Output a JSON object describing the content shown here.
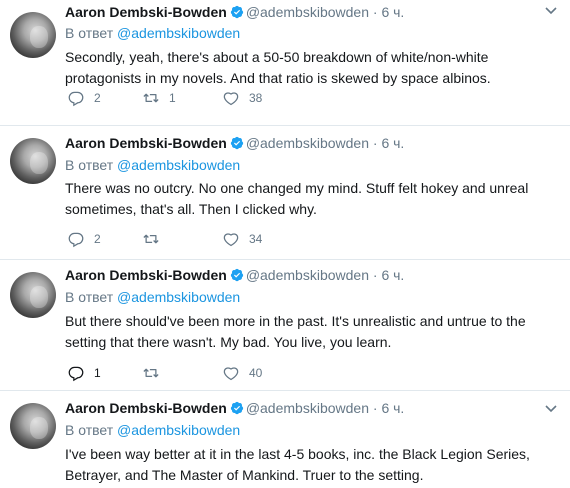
{
  "author": {
    "name": "Aaron Dembski-Bowden",
    "handle": "@adembskibowden"
  },
  "colors": {
    "text": "#14171a",
    "secondary": "#657786",
    "link": "#1b95e0",
    "divider": "#e1e8ed"
  },
  "icons": {
    "verified": "verified-badge-icon",
    "caret": "chevron-down-icon",
    "reply": "reply-icon",
    "retweet": "retweet-icon",
    "like": "heart-icon"
  },
  "tweets": [
    {
      "time": "6 ч.",
      "reply_prefix": "В ответ",
      "reply_to": "@adembskibowden",
      "text": "Secondly, yeah, there's about a 50-50 breakdown of white/non-white protagonists in my novels. And that ratio is skewed by space albinos.",
      "replies": "2",
      "retweets": "1",
      "likes": "38"
    },
    {
      "time": "6 ч.",
      "reply_prefix": "В ответ",
      "reply_to": "@adembskibowden",
      "text": "There was no outcry. No one changed my mind. Stuff felt hokey and unreal sometimes, that's all. Then I clicked why.",
      "replies": "2",
      "retweets": "",
      "likes": "34"
    },
    {
      "time": "6 ч.",
      "reply_prefix": "В ответ",
      "reply_to": "@adembskibowden",
      "text": "But there should've been more in the past. It's unrealistic and untrue to the setting that there wasn't. My bad. You live, you learn.",
      "replies": "1",
      "retweets": "",
      "likes": "40"
    },
    {
      "time": "6 ч.",
      "reply_prefix": "В ответ",
      "reply_to": "@adembskibowden",
      "text": "I've been way better at it in the last 4-5 books, inc. the Black Legion Series, Betrayer, and The Master of Mankind. Truer to the setting.",
      "replies": "",
      "retweets": "",
      "likes": ""
    }
  ]
}
